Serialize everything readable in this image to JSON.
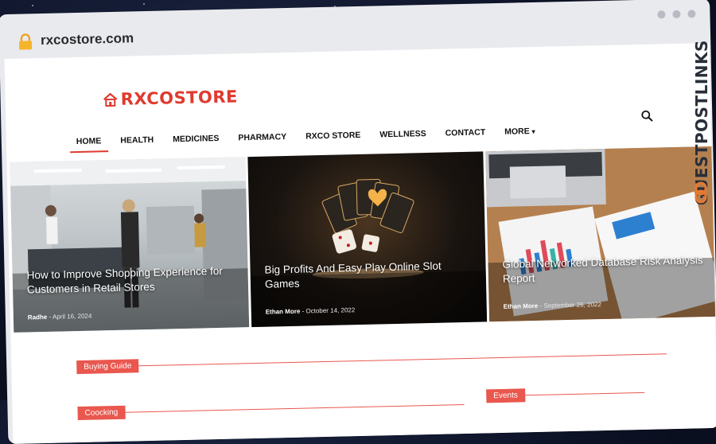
{
  "browser": {
    "url": "rxcostore.com"
  },
  "site": {
    "logo_text": "RXCOSTORE",
    "nav": [
      {
        "label": "HOME",
        "active": true
      },
      {
        "label": "HEALTH"
      },
      {
        "label": "MEDICINES"
      },
      {
        "label": "PHARMACY"
      },
      {
        "label": "RXCO STORE"
      },
      {
        "label": "WELLNESS"
      },
      {
        "label": "CONTACT"
      },
      {
        "label": "MORE"
      }
    ]
  },
  "featured": [
    {
      "title": "How to Improve Shopping Experience for Customers in Retail Stores",
      "author": "Radhe",
      "date": "April 16, 2024"
    },
    {
      "title": "Big Profits And Easy Play Online Slot Games",
      "author": "Ethan More",
      "date": "October 14, 2022"
    },
    {
      "title": "Global Networked Database Risk Analysis Report",
      "author": "Ethan More",
      "date": "September 26, 2022"
    }
  ],
  "sections": {
    "buying_guide": "Buying Guide",
    "coocking": "Coocking",
    "events": "Events"
  },
  "watermark": "GUESTPOSTLINKS",
  "colors": {
    "accent": "#e03a2f",
    "section": "#e9574e"
  }
}
